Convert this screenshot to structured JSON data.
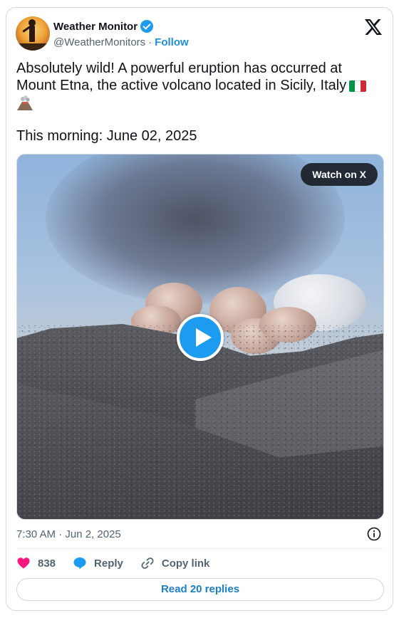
{
  "author": {
    "name": "Weather Monitor",
    "handle": "@WeatherMonitors",
    "separator": "·",
    "follow_label": "Follow"
  },
  "tweet": {
    "text": "Absolutely wild! A powerful eruption has occurred at Mount Etna, the active volcano located in Sicily, Italy",
    "flag_colors": [
      "#009246",
      "#ffffff",
      "#ce2b37"
    ],
    "date_line": "This morning: June 02, 2025"
  },
  "media": {
    "watch_label": "Watch on X",
    "play_icon": "play-icon"
  },
  "meta": {
    "timestamp": "7:30 AM · Jun 2, 2025"
  },
  "actions": {
    "likes_count": "838",
    "reply_label": "Reply",
    "copy_link_label": "Copy link"
  },
  "read_replies_label": "Read 20 replies",
  "colors": {
    "accent": "#1d9bf0",
    "heart": "#f91880",
    "text_secondary": "#536471"
  }
}
